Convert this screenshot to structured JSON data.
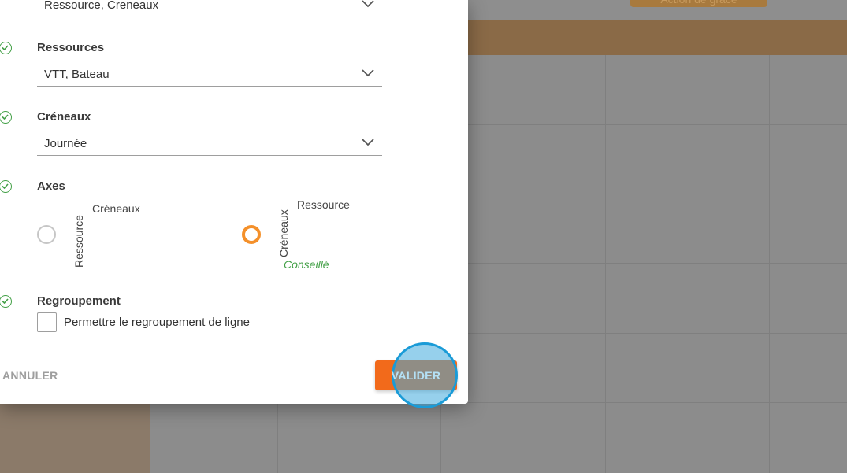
{
  "background": {
    "action_button_label": "Action de grâce"
  },
  "dialog": {
    "top_select_value": "Ressource, Creneaux",
    "ressources": {
      "label": "Ressources",
      "value": "VTT, Bateau"
    },
    "creneaux": {
      "label": "Créneaux",
      "value": "Journée"
    },
    "axes": {
      "label": "Axes",
      "option_a": {
        "top": "Créneaux",
        "side": "Ressource",
        "selected": false
      },
      "option_b": {
        "top": "Ressource",
        "side": "Créneaux",
        "selected": true,
        "note": "Conseillé"
      }
    },
    "regroupement": {
      "label": "Regroupement",
      "checkbox_label": "Permettre le regroupement de ligne",
      "checked": false
    },
    "actions": {
      "cancel": "ANNULER",
      "validate": "VALIDER"
    }
  },
  "colors": {
    "accent": "#f26a1b",
    "radio_selected": "#f4902a",
    "success": "#43a047",
    "click_indicator": "#1a9bd7"
  }
}
